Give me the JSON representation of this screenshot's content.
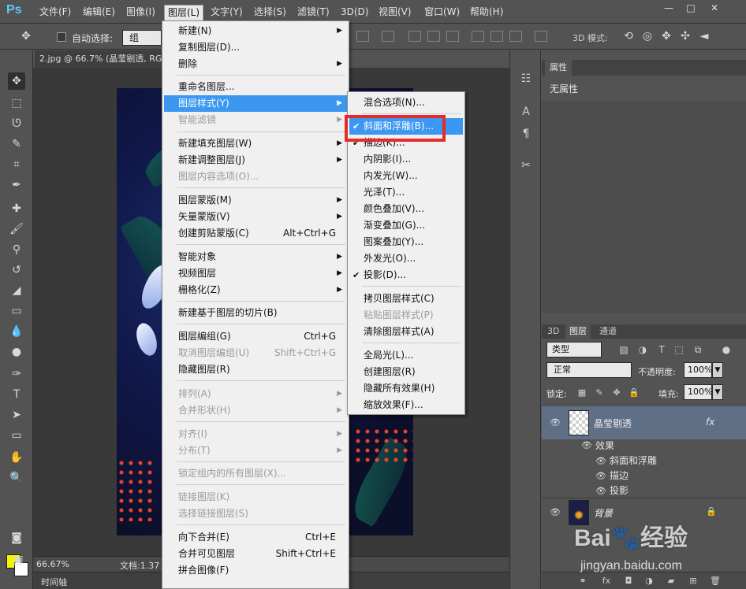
{
  "app": {
    "logo": "Ps"
  },
  "menubar": {
    "items": [
      "文件(F)",
      "编辑(E)",
      "图像(I)",
      "图层(L)",
      "文字(Y)",
      "选择(S)",
      "滤镜(T)",
      "3D(D)",
      "视图(V)",
      "窗口(W)",
      "帮助(H)"
    ],
    "window_buttons": [
      "—",
      "□",
      "✕"
    ]
  },
  "options_bar": {
    "auto_select_label": "自动选择:",
    "auto_select_value": "组",
    "mode_3d_label": "3D 模式:"
  },
  "document": {
    "tab_title": "2.jpg @ 66.7% (晶莹剔透, RGB/8)",
    "zoom": "66.67%",
    "doc_info": "文档:1.37",
    "timeline_tab": "时间轴"
  },
  "layer_menu": {
    "items": [
      {
        "label": "新建(N)",
        "shortcut": "",
        "arrow": true,
        "disabled": false
      },
      {
        "label": "复制图层(D)...",
        "shortcut": "",
        "arrow": false,
        "disabled": false
      },
      {
        "label": "删除",
        "shortcut": "",
        "arrow": true,
        "disabled": false
      },
      {
        "label": "重命名图层...",
        "shortcut": "",
        "arrow": false,
        "disabled": false
      },
      {
        "label": "图层样式(Y)",
        "shortcut": "",
        "arrow": true,
        "disabled": false,
        "highlight": true
      },
      {
        "label": "智能滤镜",
        "shortcut": "",
        "arrow": true,
        "disabled": true
      },
      {
        "label": "新建填充图层(W)",
        "shortcut": "",
        "arrow": true,
        "disabled": false
      },
      {
        "label": "新建调整图层(J)",
        "shortcut": "",
        "arrow": true,
        "disabled": false
      },
      {
        "label": "图层内容选项(O)...",
        "shortcut": "",
        "arrow": false,
        "disabled": true
      },
      {
        "label": "图层蒙版(M)",
        "shortcut": "",
        "arrow": true,
        "disabled": false
      },
      {
        "label": "矢量蒙版(V)",
        "shortcut": "",
        "arrow": true,
        "disabled": false
      },
      {
        "label": "创建剪贴蒙版(C)",
        "shortcut": "Alt+Ctrl+G",
        "arrow": false,
        "disabled": false
      },
      {
        "label": "智能对象",
        "shortcut": "",
        "arrow": true,
        "disabled": false
      },
      {
        "label": "视频图层",
        "shortcut": "",
        "arrow": true,
        "disabled": false
      },
      {
        "label": "栅格化(Z)",
        "shortcut": "",
        "arrow": true,
        "disabled": false
      },
      {
        "label": "新建基于图层的切片(B)",
        "shortcut": "",
        "arrow": false,
        "disabled": false
      },
      {
        "label": "图层编组(G)",
        "shortcut": "Ctrl+G",
        "arrow": false,
        "disabled": false
      },
      {
        "label": "取消图层编组(U)",
        "shortcut": "Shift+Ctrl+G",
        "arrow": false,
        "disabled": true
      },
      {
        "label": "隐藏图层(R)",
        "shortcut": "",
        "arrow": false,
        "disabled": false
      },
      {
        "label": "排列(A)",
        "shortcut": "",
        "arrow": true,
        "disabled": true
      },
      {
        "label": "合并形状(H)",
        "shortcut": "",
        "arrow": true,
        "disabled": true
      },
      {
        "label": "对齐(I)",
        "shortcut": "",
        "arrow": true,
        "disabled": true
      },
      {
        "label": "分布(T)",
        "shortcut": "",
        "arrow": true,
        "disabled": true
      },
      {
        "label": "锁定组内的所有图层(X)...",
        "shortcut": "",
        "arrow": false,
        "disabled": true
      },
      {
        "label": "链接图层(K)",
        "shortcut": "",
        "arrow": false,
        "disabled": true
      },
      {
        "label": "选择链接图层(S)",
        "shortcut": "",
        "arrow": false,
        "disabled": true
      },
      {
        "label": "向下合并(E)",
        "shortcut": "Ctrl+E",
        "arrow": false,
        "disabled": false
      },
      {
        "label": "合并可见图层",
        "shortcut": "Shift+Ctrl+E",
        "arrow": false,
        "disabled": false
      },
      {
        "label": "拼合图像(F)",
        "shortcut": "",
        "arrow": false,
        "disabled": false
      }
    ]
  },
  "style_menu": {
    "items": [
      {
        "label": "混合选项(N)...",
        "checked": false,
        "disabled": false
      },
      {
        "label": "斜面和浮雕(B)...",
        "checked": true,
        "disabled": false,
        "highlight": true
      },
      {
        "label": "描边(K)...",
        "checked": true,
        "disabled": false
      },
      {
        "label": "内阴影(I)...",
        "checked": false,
        "disabled": false
      },
      {
        "label": "内发光(W)...",
        "checked": false,
        "disabled": false
      },
      {
        "label": "光泽(T)...",
        "checked": false,
        "disabled": false
      },
      {
        "label": "颜色叠加(V)...",
        "checked": false,
        "disabled": false
      },
      {
        "label": "渐变叠加(G)...",
        "checked": false,
        "disabled": false
      },
      {
        "label": "图案叠加(Y)...",
        "checked": false,
        "disabled": false
      },
      {
        "label": "外发光(O)...",
        "checked": false,
        "disabled": false
      },
      {
        "label": "投影(D)...",
        "checked": true,
        "disabled": false
      },
      {
        "label": "拷贝图层样式(C)",
        "checked": false,
        "disabled": false
      },
      {
        "label": "粘贴图层样式(P)",
        "checked": false,
        "disabled": true
      },
      {
        "label": "清除图层样式(A)",
        "checked": false,
        "disabled": false
      },
      {
        "label": "全局光(L)...",
        "checked": false,
        "disabled": false
      },
      {
        "label": "创建图层(R)",
        "checked": false,
        "disabled": false
      },
      {
        "label": "隐藏所有效果(H)",
        "checked": false,
        "disabled": false
      },
      {
        "label": "缩放效果(F)...",
        "checked": false,
        "disabled": false
      }
    ]
  },
  "properties_panel": {
    "tab": "属性",
    "no_properties": "无属性"
  },
  "layers_panel": {
    "tabs": [
      "3D",
      "图层",
      "通道"
    ],
    "active_tab": "图层",
    "filter_label": "类型",
    "blend_mode": "正常",
    "opacity_label": "不透明度:",
    "opacity_value": "100%",
    "lock_label": "锁定:",
    "fill_label": "填充:",
    "fill_value": "100%",
    "layers": [
      {
        "name": "晶莹剔透",
        "effects_label": "效果",
        "effects": [
          "斜面和浮雕",
          "描边",
          "投影"
        ]
      },
      {
        "name": "背景"
      }
    ]
  },
  "colors": {
    "foreground": "#f5f500",
    "background": "#ffffff",
    "menu_highlight": "#3c97f0",
    "annotation_box": "#ea2a2a"
  },
  "watermark": {
    "logo_text": "Bai du 经验",
    "url": "jingyan.baidu.com"
  }
}
